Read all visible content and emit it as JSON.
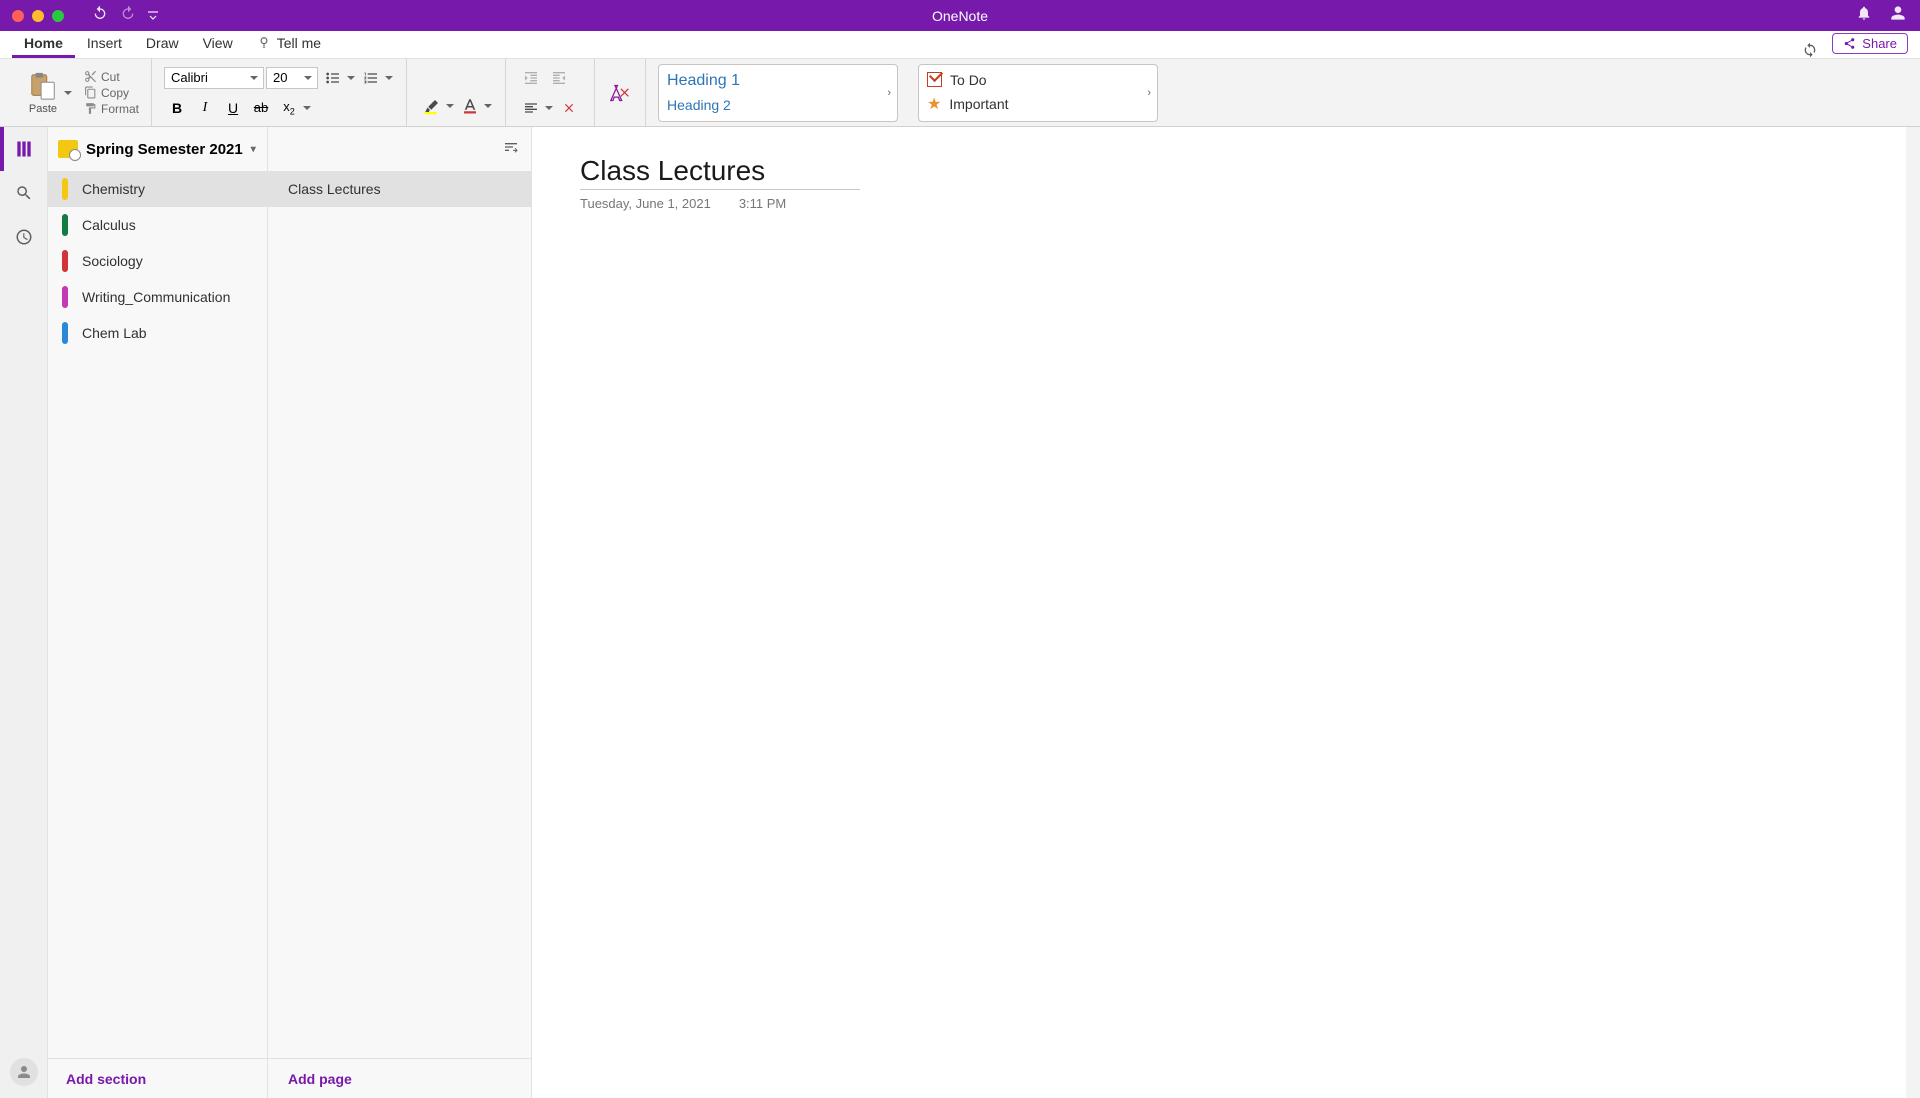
{
  "app_title": "OneNote",
  "tabs": {
    "home": "Home",
    "insert": "Insert",
    "draw": "Draw",
    "view": "View",
    "tellme": "Tell me"
  },
  "share_label": "Share",
  "ribbon": {
    "paste": "Paste",
    "cut": "Cut",
    "copy": "Copy",
    "format": "Format",
    "font_name": "Calibri",
    "font_size": "20",
    "heading1": "Heading 1",
    "heading2": "Heading 2",
    "todo": "To Do",
    "important": "Important"
  },
  "notebook": {
    "name": "Spring Semester 2021"
  },
  "sections": [
    {
      "name": "Chemistry",
      "color": "#f2c811",
      "active": true
    },
    {
      "name": "Calculus",
      "color": "#107c41"
    },
    {
      "name": "Sociology",
      "color": "#d13438"
    },
    {
      "name": "Writing_Communication",
      "color": "#c239b3"
    },
    {
      "name": "Chem Lab",
      "color": "#2b88d8"
    }
  ],
  "add_section": "Add section",
  "pages": [
    {
      "name": "Class Lectures",
      "active": true
    }
  ],
  "add_page": "Add page",
  "page": {
    "title": "Class Lectures",
    "date": "Tuesday, June 1, 2021",
    "time": "3:11 PM"
  }
}
